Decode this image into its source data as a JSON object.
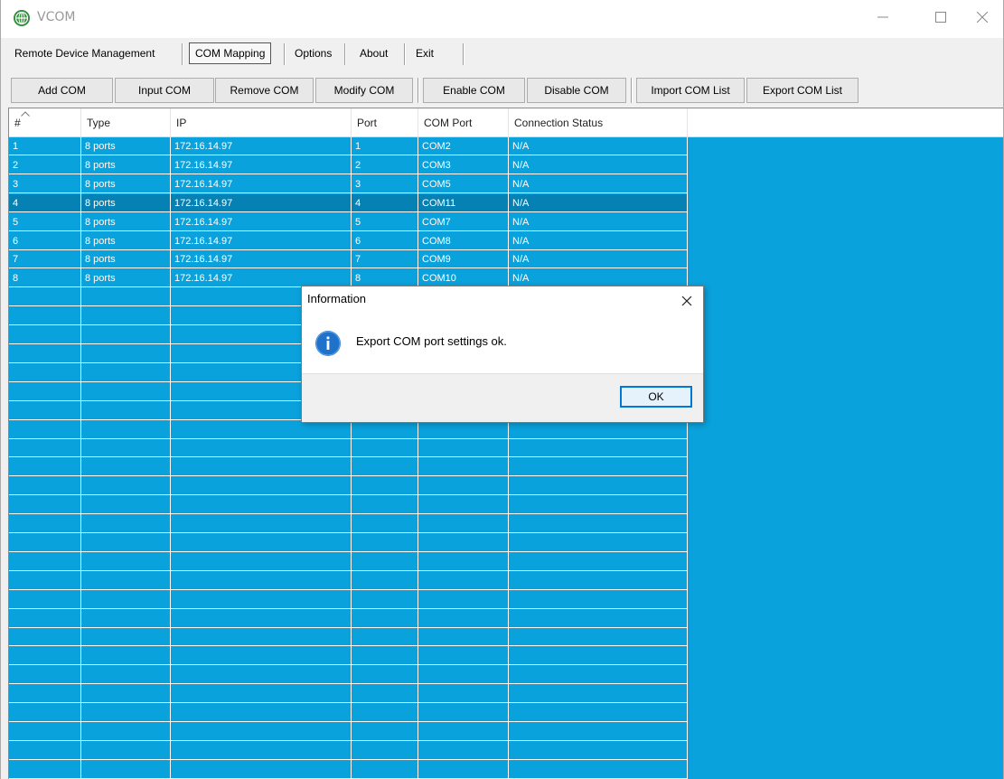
{
  "window": {
    "title": "VCOM"
  },
  "menu": {
    "items": [
      {
        "label": "Remote Device Management",
        "underline": "R",
        "active": false
      },
      {
        "label": "COM Mapping",
        "underline": "C",
        "active": true
      },
      {
        "label": "Options",
        "underline": "O",
        "active": false
      },
      {
        "label": "About",
        "underline": "A",
        "active": false
      },
      {
        "label": "Exit",
        "underline": "E",
        "active": false
      }
    ]
  },
  "toolbar": {
    "buttons": [
      {
        "label": "Add COM"
      },
      {
        "label": "Input COM"
      },
      {
        "label": "Remove COM"
      },
      {
        "label": "Modify COM"
      },
      {
        "label": "Enable COM"
      },
      {
        "label": "Disable COM"
      },
      {
        "label": "Import COM List"
      },
      {
        "label": "Export COM List"
      }
    ]
  },
  "table": {
    "columns": [
      "#",
      "Type",
      "IP",
      "Port",
      "COM Port",
      "Connection Status"
    ],
    "rows": [
      [
        "1",
        "8 ports",
        "172.16.14.97",
        "1",
        "COM2",
        "N/A"
      ],
      [
        "2",
        "8 ports",
        "172.16.14.97",
        "2",
        "COM3",
        "N/A"
      ],
      [
        "3",
        "8 ports",
        "172.16.14.97",
        "3",
        "COM5",
        "N/A"
      ],
      [
        "4",
        "8 ports",
        "172.16.14.97",
        "4",
        "COM11",
        "N/A"
      ],
      [
        "5",
        "8 ports",
        "172.16.14.97",
        "5",
        "COM7",
        "N/A"
      ],
      [
        "6",
        "8 ports",
        "172.16.14.97",
        "6",
        "COM8",
        "N/A"
      ],
      [
        "7",
        "8 ports",
        "172.16.14.97",
        "7",
        "COM9",
        "N/A"
      ],
      [
        "8",
        "8 ports",
        "172.16.14.97",
        "8",
        "COM10",
        "N/A"
      ]
    ],
    "selected_row": 3
  },
  "dialog": {
    "title": "Information",
    "message": "Export COM port settings ok.",
    "ok_label": "OK",
    "icon": "info-icon"
  },
  "colors": {
    "grid_background": "#0aa2dc",
    "selected_row": "#0681b4",
    "accent": "#0078d7"
  }
}
